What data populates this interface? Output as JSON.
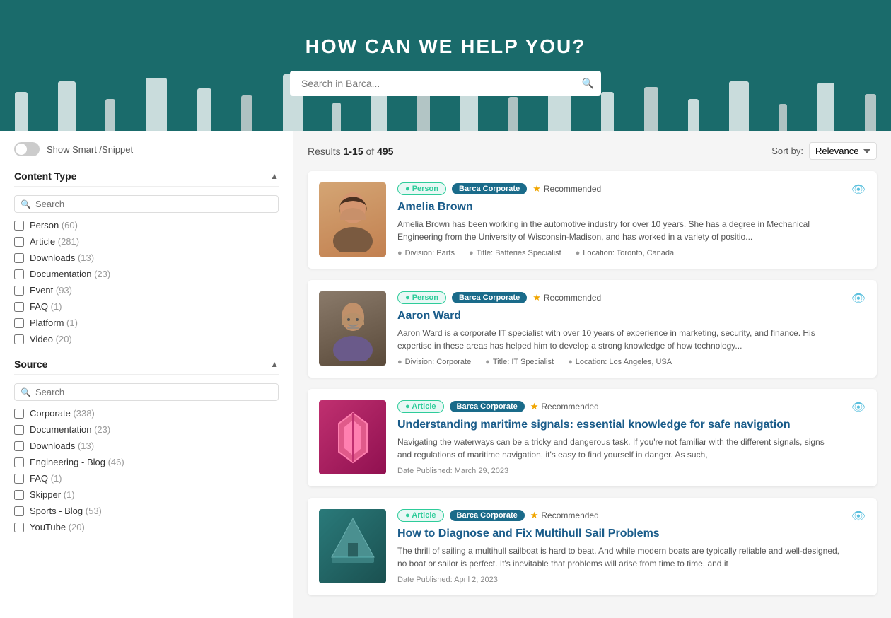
{
  "hero": {
    "title": "HOW CAN WE HELP YOU?",
    "search_placeholder": "Search in Barca..."
  },
  "toolbar": {
    "smart_snippet_label": "Show Smart /Snippet",
    "results_text": "Results",
    "results_range": "1-15",
    "results_of": "of",
    "results_total": "495",
    "sort_label": "Sort by:",
    "sort_value": "Relevance"
  },
  "sidebar": {
    "content_type": {
      "heading": "Content Type",
      "search_placeholder": "Search",
      "items": [
        {
          "label": "Person",
          "count": "(60)"
        },
        {
          "label": "Article",
          "count": "(281)"
        },
        {
          "label": "Downloads",
          "count": "(13)"
        },
        {
          "label": "Documentation",
          "count": "(23)"
        },
        {
          "label": "Event",
          "count": "(93)"
        },
        {
          "label": "FAQ",
          "count": "(1)"
        },
        {
          "label": "Platform",
          "count": "(1)"
        },
        {
          "label": "Video",
          "count": "(20)"
        }
      ]
    },
    "source": {
      "heading": "Source",
      "search_placeholder": "Search",
      "items": [
        {
          "label": "Corporate",
          "count": "(338)"
        },
        {
          "label": "Documentation",
          "count": "(23)"
        },
        {
          "label": "Downloads",
          "count": "(13)"
        },
        {
          "label": "Engineering - Blog",
          "count": "(46)"
        },
        {
          "label": "FAQ",
          "count": "(1)"
        },
        {
          "label": "Skipper",
          "count": "(1)"
        },
        {
          "label": "Sports - Blog",
          "count": "(53)"
        },
        {
          "label": "YouTube",
          "count": "(20)"
        }
      ]
    }
  },
  "results": [
    {
      "id": "amelia-brown",
      "tag_type": "Person",
      "tag_source": "Barca Corporate",
      "recommended": true,
      "recommended_label": "Recommended",
      "title": "Amelia Brown",
      "description": "Amelia Brown has been working in the automotive industry for over 10 years. She has a degree in Mechanical Engineering from the University of Wisconsin-Madison, and has worked in a variety of positio...",
      "meta": [
        {
          "icon": "person-icon",
          "label": "Division: Parts"
        },
        {
          "icon": "badge-icon",
          "label": "Title: Batteries Specialist"
        },
        {
          "icon": "location-icon",
          "label": "Location: Toronto, Canada"
        }
      ],
      "type": "person1"
    },
    {
      "id": "aaron-ward",
      "tag_type": "Person",
      "tag_source": "Barca Corporate",
      "recommended": true,
      "recommended_label": "Recommended",
      "title": "Aaron Ward",
      "description": "Aaron Ward is a corporate IT specialist with over 10 years of experience in marketing, security, and finance. His expertise in these areas has helped him to develop a strong knowledge of how technology...",
      "meta": [
        {
          "icon": "person-icon",
          "label": "Division: Corporate"
        },
        {
          "icon": "badge-icon",
          "label": "Title: IT Specialist"
        },
        {
          "icon": "location-icon",
          "label": "Location: Los Angeles, USA"
        }
      ],
      "type": "person2"
    },
    {
      "id": "maritime-signals",
      "tag_type": "Article",
      "tag_source": "Barca Corporate",
      "recommended": true,
      "recommended_label": "Recommended",
      "title": "Understanding maritime signals: essential knowledge for safe navigation",
      "description": "Navigating the waterways can be a tricky and dangerous task. If you're not familiar with the different signals, signs and regulations of maritime navigation, it's easy to find yourself in danger. As such,",
      "date": "Date Published: March 29, 2023",
      "meta": [],
      "type": "article1"
    },
    {
      "id": "multihull-sail",
      "tag_type": "Article",
      "tag_source": "Barca Corporate",
      "recommended": true,
      "recommended_label": "Recommended",
      "title": "How to Diagnose and Fix Multihull Sail Problems",
      "description": "The thrill of sailing a multihull sailboat is hard to beat. And while modern boats are typically reliable and well-designed, no boat or sailor is perfect. It's inevitable that problems will arise from time to time, and it",
      "date": "Date Published: April 2, 2023",
      "meta": [],
      "type": "article2"
    }
  ]
}
